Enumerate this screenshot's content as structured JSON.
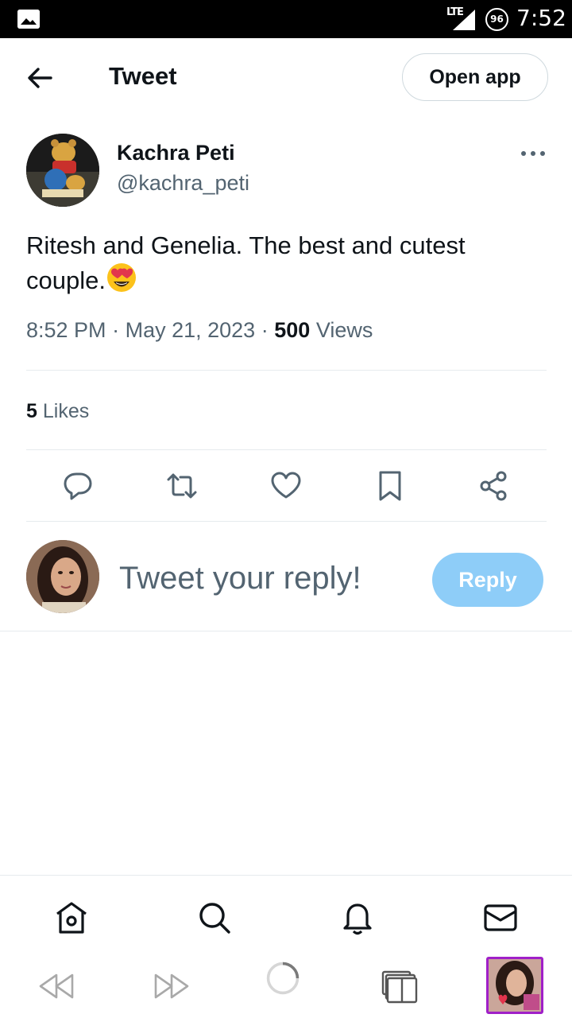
{
  "status_bar": {
    "network": "LTE",
    "battery": "96",
    "time": "7:52"
  },
  "header": {
    "title": "Tweet",
    "open_app_label": "Open app"
  },
  "tweet": {
    "author_name": "Kachra Peti",
    "author_handle": "@kachra_peti",
    "text": "Ritesh and Genelia. The best and cutest couple.",
    "emoji": "smiling-face-with-heart-eyes",
    "time": "8:52 PM",
    "date": "May 21, 2023",
    "separator": "·",
    "views_count": "500",
    "views_label": "Views",
    "likes_count": "5",
    "likes_label": "Likes"
  },
  "actions": [
    "reply-icon",
    "retweet-icon",
    "like-icon",
    "bookmark-icon",
    "share-icon"
  ],
  "reply": {
    "placeholder": "Tweet your reply!",
    "button_label": "Reply"
  },
  "tab_bar": [
    "home-icon",
    "search-icon",
    "notifications-icon",
    "messages-icon"
  ],
  "browser_nav": [
    "rewind-icon",
    "fast-forward-icon",
    "loading-icon",
    "tabs-icon",
    "tab-thumbnail"
  ],
  "colors": {
    "text_primary": "#0f1419",
    "text_secondary": "#536471",
    "reply_button": "#8ecdf8",
    "divider": "#e6ebee",
    "thumbnail_border": "#a020c8"
  }
}
